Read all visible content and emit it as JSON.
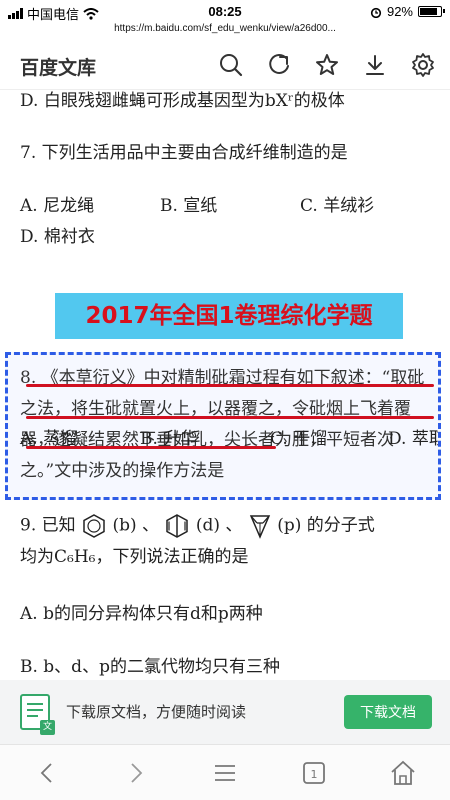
{
  "status": {
    "carrier": "中国电信",
    "time": "08:25",
    "battery": "92%",
    "battery_level": 0.92
  },
  "url": "https://m.baidu.com/sf_edu_wenku/view/a26d00...",
  "header": {
    "brand": "百度文库"
  },
  "icons": [
    "search-icon",
    "refresh-icon",
    "star-icon",
    "download-icon",
    "settings-icon"
  ],
  "doc": {
    "line_d6": "D. 白眼残翅雌蝇可形成基因型为bXʳ的极体",
    "q7": "7. 下列生活用品中主要由合成纤维制造的是",
    "q7_a": "A. 尼龙绳",
    "q7_b": "B. 宣纸",
    "q7_c": "C. 羊绒衫",
    "q7_d": "D. 棉衬衣",
    "banner": "2017年全国1卷理综化学题",
    "q8": "8. 《本草衍义》中对精制砒霜过程有如下叙述：“取砒之法，将生砒就置火上，以器覆之，令砒烟上飞着覆器，遂凝结累然下垂如乳，尖长者为胜，平短者次之。”文中涉及的操作方法是",
    "q8_a": "A. 蒸馏",
    "q8_b": "B. 升华",
    "q8_c": "C. 干馏",
    "q8_d": "D. 萃取",
    "q9_prefix": "9. 已知",
    "q9_b": "(b) 、",
    "q9_d": "(d) 、",
    "q9_p": "(p) 的分子式",
    "q9_line2": "均为C₆H₆，下列说法正确的是",
    "q9_a": "A. b的同分异构体只有d和p两种",
    "q9_bopt": "B. b、d、p的二氯代物均只有三种"
  },
  "download_bar": {
    "text": "下载原文档，方便随时阅读",
    "button": "下载文档"
  },
  "nav": [
    "back-icon",
    "forward-icon",
    "menu-icon",
    "tabs-icon",
    "home-icon"
  ],
  "colors": {
    "accent_green": "#36b36a",
    "banner_bg": "#52c8ef",
    "banner_text": "#d8101c",
    "box_blue": "#2e5ce6",
    "underline_red": "#d01020"
  }
}
